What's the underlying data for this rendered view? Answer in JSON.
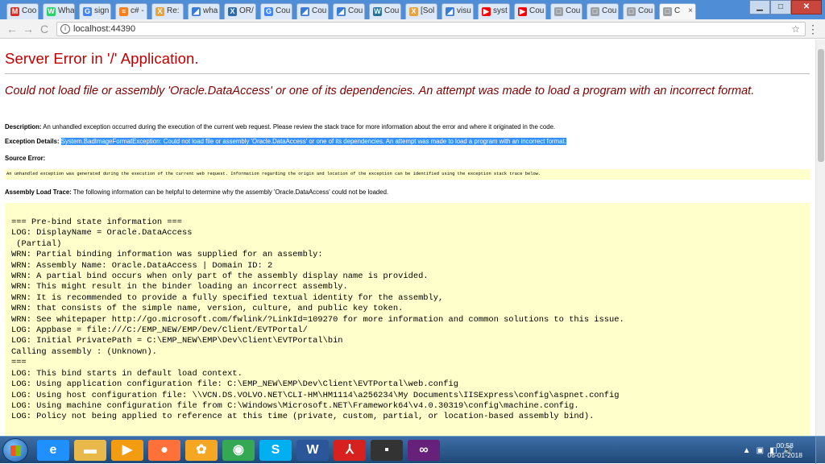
{
  "browser": {
    "tabs": [
      {
        "label": "Coo",
        "icon": "M",
        "color": "#d93025"
      },
      {
        "label": "Wha",
        "icon": "W",
        "color": "#25d366"
      },
      {
        "label": "sign",
        "icon": "G",
        "color": "#4285f4"
      },
      {
        "label": "c# -",
        "icon": "≡",
        "color": "#f48024"
      },
      {
        "label": "Re:",
        "icon": "X",
        "color": "#e7a33e"
      },
      {
        "label": "wha",
        "icon": "◢",
        "color": "#3a7bd5"
      },
      {
        "label": "OR/",
        "icon": "X",
        "color": "#2b6cb0"
      },
      {
        "label": "Cou",
        "icon": "G",
        "color": "#4285f4"
      },
      {
        "label": "Cou",
        "icon": "◢",
        "color": "#3a7bd5"
      },
      {
        "label": "Cou",
        "icon": "◢",
        "color": "#3a7bd5"
      },
      {
        "label": "Cou",
        "icon": "W",
        "color": "#21759b"
      },
      {
        "label": "[Sol",
        "icon": "X",
        "color": "#e7a33e"
      },
      {
        "label": "visu",
        "icon": "◢",
        "color": "#3a7bd5"
      },
      {
        "label": "syst",
        "icon": "▶",
        "color": "#ff0000"
      },
      {
        "label": "Cou",
        "icon": "▶",
        "color": "#ff0000"
      },
      {
        "label": "Cou",
        "icon": "□",
        "color": "#9aa0a6"
      },
      {
        "label": "Cou",
        "icon": "□",
        "color": "#9aa0a6"
      },
      {
        "label": "Cou",
        "icon": "□",
        "color": "#9aa0a6"
      }
    ],
    "active_tab": {
      "label": "C",
      "close": "×"
    },
    "url": "localhost:44390",
    "nav": {
      "back": "←",
      "forward": "→",
      "reload": "C"
    },
    "star": "☆",
    "menu": "⋮",
    "window_buttons": {
      "minimize": "▁",
      "maximize": "□",
      "close": "✕"
    }
  },
  "error_page": {
    "title": "Server Error in '/' Application.",
    "message": "Could not load file or assembly 'Oracle.DataAccess' or one of its dependencies. An attempt was made to load a program with an incorrect format.",
    "description_label": "Description:",
    "description_text": "An unhandled exception occurred during the execution of the current web request. Please review the stack trace for more information about the error and where it originated in the code.",
    "exception_label": "Exception Details:",
    "exception_text": "System.BadImageFormatException: Could not load file or assembly 'Oracle.DataAccess' or one of its dependencies. An attempt was made to load a program with an incorrect format.",
    "source_label": "Source Error:",
    "source_text": "An unhandled exception was generated during the execution of the current web request. Information regarding the origin and location of the exception can be identified using the exception stack trace below.",
    "assembly_label": "Assembly Load Trace:",
    "assembly_text": "The following information can be helpful to determine why the assembly 'Oracle.DataAccess' could not be loaded.",
    "trace_lines": [
      "=== Pre-bind state information ===",
      "LOG: DisplayName = Oracle.DataAccess",
      " (Partial)",
      "WRN: Partial binding information was supplied for an assembly:",
      "WRN: Assembly Name: Oracle.DataAccess | Domain ID: 2",
      "WRN: A partial bind occurs when only part of the assembly display name is provided.",
      "WRN: This might result in the binder loading an incorrect assembly.",
      "WRN: It is recommended to provide a fully specified textual identity for the assembly,",
      "WRN: that consists of the simple name, version, culture, and public key token.",
      "WRN: See whitepaper http://go.microsoft.com/fwlink/?LinkId=109270 for more information and common solutions to this issue.",
      "LOG: Appbase = file:///C:/EMP_NEW/EMP/Dev/Client/EVTPortal/",
      "LOG: Initial PrivatePath = C:\\EMP_NEW\\EMP\\Dev\\Client\\EVTPortal\\bin",
      "Calling assembly : (Unknown).",
      "===",
      "LOG: This bind starts in default load context.",
      "LOG: Using application configuration file: C:\\EMP_NEW\\EMP\\Dev\\Client\\EVTPortal\\web.config",
      "LOG: Using host configuration file: \\\\VCN.DS.VOLVO.NET\\CLI-HM\\HM1114\\a256234\\My Documents\\IISExpress\\config\\aspnet.config",
      "LOG: Using machine configuration file from C:\\Windows\\Microsoft.NET\\Framework64\\v4.0.30319\\config\\machine.config.",
      "LOG: Policy not being applied to reference at this time (private, custom, partial, or location-based assembly bind)."
    ]
  },
  "taskbar": {
    "apps": [
      {
        "name": "ie-icon",
        "glyph": "e",
        "color": "#1e90ff"
      },
      {
        "name": "explorer-icon",
        "glyph": "▬",
        "color": "#e8b84a"
      },
      {
        "name": "media-player-icon",
        "glyph": "▶",
        "color": "#f39c12"
      },
      {
        "name": "firefox-icon",
        "glyph": "●",
        "color": "#ff7139"
      },
      {
        "name": "uc-browser-icon",
        "glyph": "✿",
        "color": "#f5a623"
      },
      {
        "name": "chrome-icon",
        "glyph": "◉",
        "color": "#34a853"
      },
      {
        "name": "skype-icon",
        "glyph": "S",
        "color": "#00aff0"
      },
      {
        "name": "word-icon",
        "glyph": "W",
        "color": "#2b579a"
      },
      {
        "name": "acrobat-icon",
        "glyph": "⅄",
        "color": "#d7211f"
      },
      {
        "name": "cmd-icon",
        "glyph": "▪",
        "color": "#333333"
      },
      {
        "name": "visual-studio-icon",
        "glyph": "∞",
        "color": "#68217a"
      }
    ],
    "tray": {
      "arrow": "▲",
      "icons": [
        "▣",
        "◧",
        "🔊"
      ]
    },
    "time": "00:58",
    "date": "06-01-2018"
  }
}
